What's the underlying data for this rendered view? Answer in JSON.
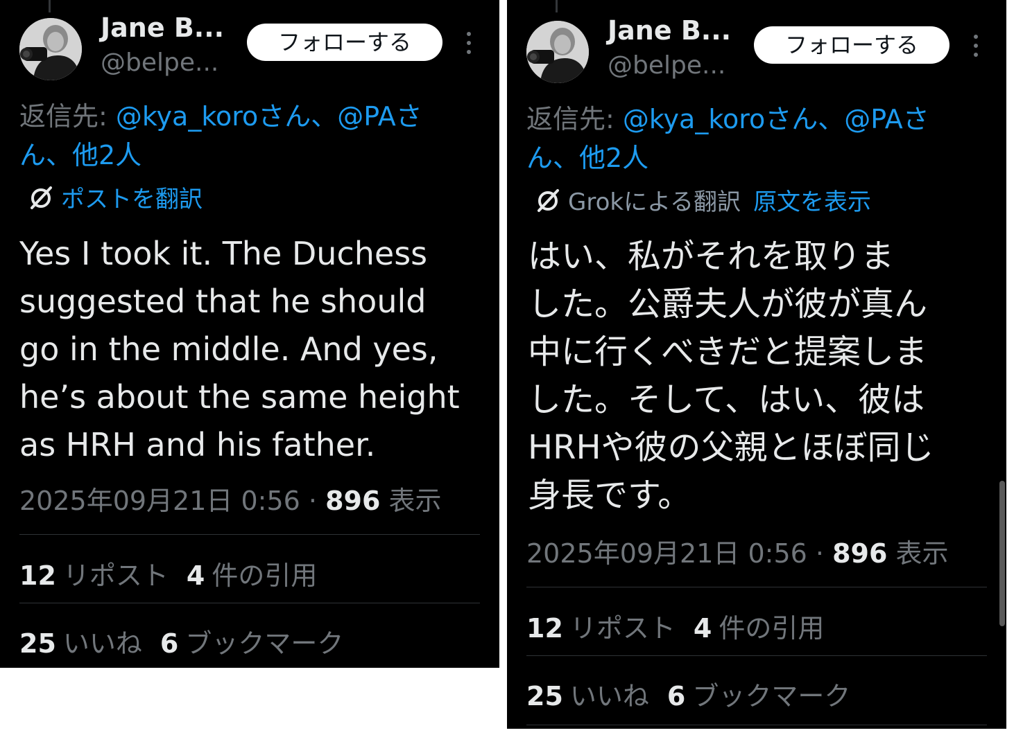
{
  "left_panel": {
    "user": {
      "name": "Jane B...",
      "handle": "@belpe..."
    },
    "follow_label": "フォローする",
    "reply_to": {
      "prefix": "返信先: ",
      "mention1": "@kya_koroさん、@PAさ",
      "mention2": "ん、他2人"
    },
    "translate_link": "ポストを翻訳",
    "text_lines": [
      "Yes I took it. The Duchess",
      "suggested that he should",
      "go in the middle. And yes,",
      "he’s about the same height",
      "as HRH and his father."
    ],
    "timestamp": "2025年09月21日 0:56 · ",
    "views_count": "896",
    "views_label": " 表示",
    "stats": {
      "reposts_count": "12",
      "reposts_label": "リポスト",
      "quotes_count": "4",
      "quotes_label": "件の引用",
      "likes_count": "25",
      "likes_label": "いいね",
      "bookmarks_count": "6",
      "bookmarks_label": "ブックマーク"
    }
  },
  "right_panel": {
    "user": {
      "name": "Jane B...",
      "handle": "@belpe..."
    },
    "follow_label": "フォローする",
    "reply_to": {
      "prefix": "返信先: ",
      "mention1": "@kya_koroさん、@PAさ",
      "mention2": "ん、他2人"
    },
    "translation_label": "Grokによる翻訳",
    "show_original_link": "原文を表示",
    "text_lines": [
      "はい、私がそれを取りま",
      "した。公爵夫人が彼が真ん",
      "中に行くべきだと提案しま",
      "した。そして、はい、彼は",
      "HRHや彼の父親とほぼ同じ",
      "身長です。"
    ],
    "timestamp": "2025年09月21日 0:56 · ",
    "views_count": "896",
    "views_label": " 表示",
    "stats": {
      "reposts_count": "12",
      "reposts_label": "リポスト",
      "quotes_count": "4",
      "quotes_label": "件の引用",
      "likes_count": "25",
      "likes_label": "いいね",
      "bookmarks_count": "6",
      "bookmarks_label": "ブックマーク"
    }
  },
  "colors": {
    "background": "#000000",
    "text": "#e7e9ea",
    "muted": "#71767b",
    "link": "#1d9bf0"
  },
  "icons": [
    "avatar-photo",
    "more-dots-icon",
    "grok-slash-icon"
  ]
}
